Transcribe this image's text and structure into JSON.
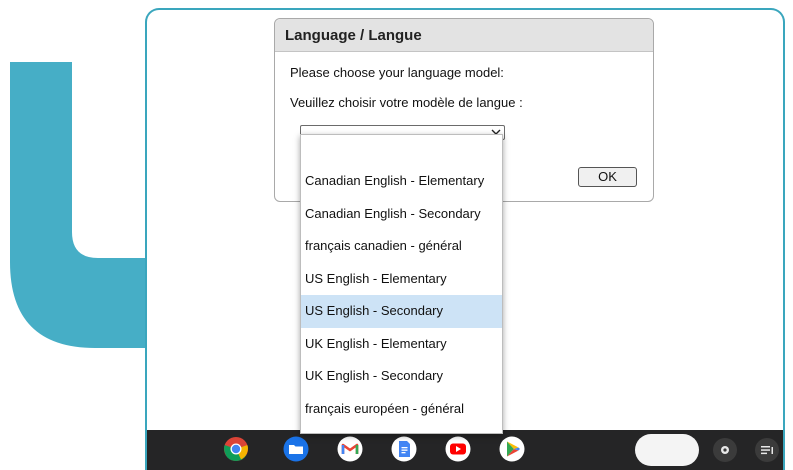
{
  "dialog": {
    "title": "Language / Langue",
    "prompt_en": "Please choose your language model:",
    "prompt_fr": "Veuillez choisir votre modèle de langue :",
    "ok_label": "OK"
  },
  "select": {
    "current_value": ""
  },
  "dropdown": {
    "selected_index": 4,
    "options": [
      "Canadian English - Elementary",
      "Canadian English - Secondary",
      "français canadien - général",
      "US English - Elementary",
      "US English - Secondary",
      "UK English - Elementary",
      "UK English - Secondary",
      "français européen - général"
    ]
  },
  "shelf": {
    "apps": [
      "chrome-icon",
      "files-icon",
      "gmail-icon",
      "docs-icon",
      "youtube-icon",
      "play-store-icon"
    ]
  },
  "colors": {
    "arrow": "#46aec6",
    "frame": "#3aa6bd",
    "selected_option": "#cde3f6",
    "shelf": "#252526"
  }
}
